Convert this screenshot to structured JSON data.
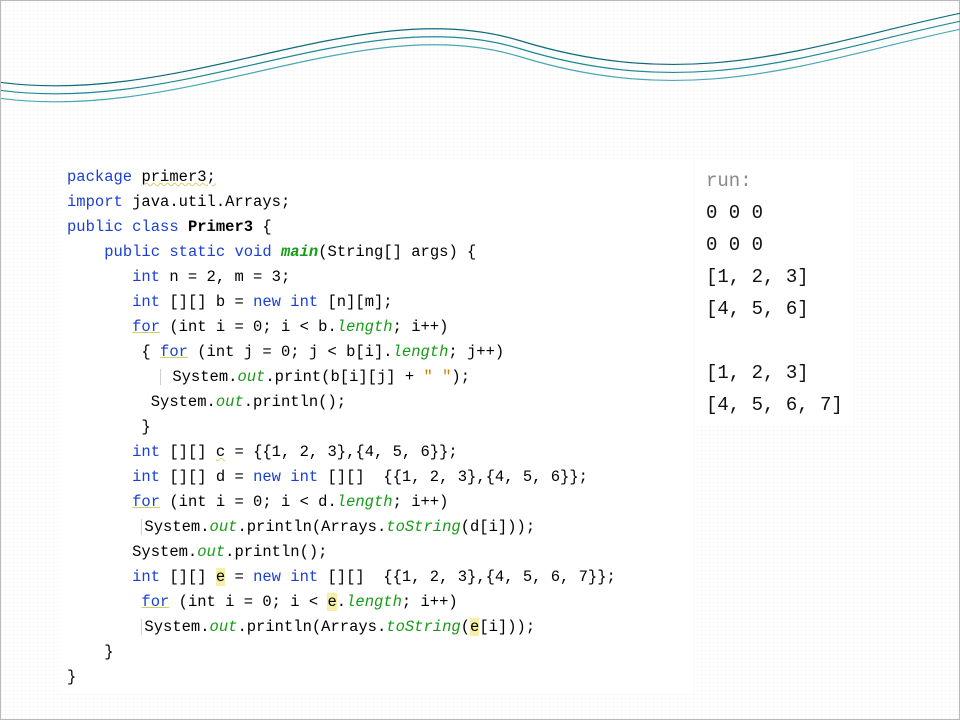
{
  "colors": {
    "wave1": "#0d6b7a",
    "wave2": "#4aa8b5"
  },
  "output": {
    "run_label": "run:",
    "lines": [
      "0 0 0",
      "0 0 0",
      "[1, 2, 3]",
      "[4, 5, 6]",
      "",
      "[1, 2, 3]",
      "[4, 5, 6, 7]"
    ]
  },
  "code": {
    "kw_package": "package",
    "pkg_name": "primer3;",
    "kw_import": "import",
    "import_stmt": "java.util.Arrays;",
    "kw_public": "public",
    "kw_class": "class",
    "class_name": "Primer3",
    "kw_static": "static",
    "kw_void": "void",
    "main": "main",
    "main_sig": "(String[] args) {",
    "line_nm": "int n = 2, m = 3;",
    "kw_int": "int",
    "decl_b_left": "[][] b = ",
    "kw_new": "new",
    "decl_b_right": "int [n][m];",
    "kw_for": "for",
    "for_b_outer": "(int i = 0; i < b.",
    "length": "length",
    "semicolon_ipp": "; i++)",
    "for_b_inner_open": "{ ",
    "for_b_inner_args": "(int j = 0; j < b[i].",
    "for_b_inner_tail": "; j++)",
    "sout_obj": "System.",
    "out": "out",
    "print": ".print",
    "print_b": "(b[i][j] + ",
    "str_space": "\" \"",
    "print_b_end": ");",
    "println": ".println",
    "println_empty": "();",
    "brace_close": "}",
    "decl_c": "[][] ",
    "c_var": "c",
    "c_init": " = {{1, 2, 3},{4, 5, 6}};",
    "decl_d_left": "[][] d = ",
    "decl_d_right": "int [][]  {{1, 2, 3},{4, 5, 6}};",
    "for_d": "(int i = 0; i < d.",
    "println_tok": ".println(Arrays.",
    "toString": "toString",
    "toString_d": "(d[i]));",
    "decl_e_left": " [][] ",
    "e_var": "e",
    "decl_e_mid": " = ",
    "decl_e_right": "int [][]  {{1, 2, 3},{4, 5, 6, 7}};",
    "for_e_open": "(int i = 0; i < ",
    "for_e_close": ".",
    "toString_e_open": "(",
    "toString_e_close": "[i]));"
  }
}
